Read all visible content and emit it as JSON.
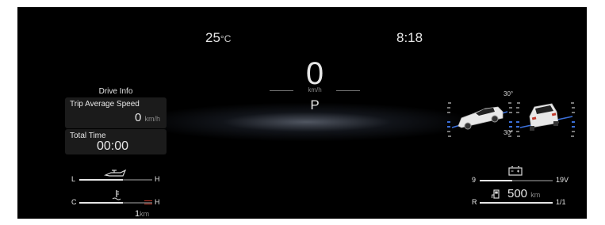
{
  "header": {
    "temperature_value": "25",
    "temperature_unit": "°C",
    "clock": "8:18"
  },
  "speedometer": {
    "speed": "0",
    "unit": "km/h",
    "gear": "P"
  },
  "drive_info": {
    "title": "Drive Info",
    "trip_average_speed": {
      "label": "Trip Average Speed",
      "value": "0",
      "unit": "km/h"
    },
    "total_time": {
      "label": "Total Time",
      "value": "00:00"
    }
  },
  "oil_gauge": {
    "low_label": "L",
    "high_label": "H",
    "icon": "oil-can-icon",
    "level": 0.6
  },
  "temp_gauge": {
    "low_label": "C",
    "high_label": "H",
    "icon": "coolant-temperature-icon",
    "level": 0.6,
    "accent": "#c0392b"
  },
  "odometer_small": {
    "value": "1",
    "unit": "km"
  },
  "battery_gauge": {
    "low_label": "9",
    "high_label": "19V",
    "icon": "battery-icon",
    "level": 0.45
  },
  "fuel_gauge": {
    "low_label": "R",
    "high_label": "1/1",
    "icon": "fuel-pump-icon",
    "level": 1.0,
    "range_value": "500",
    "range_unit": "km"
  },
  "inclinometer": {
    "pitch_label": "30°",
    "roll_label": "30°",
    "pitch_icon": "vehicle-side-view-icon",
    "roll_icon": "vehicle-rear-view-icon",
    "accent": "#3b6fd8"
  },
  "colors": {
    "background": "#000000",
    "text": "#e6e6e6",
    "panel": "#1b1b1b",
    "muted": "#8a8a8a"
  }
}
